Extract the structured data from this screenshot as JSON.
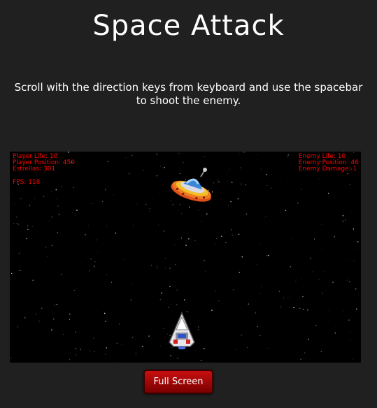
{
  "page": {
    "title": "Space Attack",
    "instructions": "Scroll with the direction keys from keyboard and use the spacebar to shoot the enemy."
  },
  "hud": {
    "player_life": "Player Life: 10",
    "player_position": "Player Position: 450",
    "stars": "Estrellas: 301",
    "fps": "FPS: 118",
    "enemy_life": "Enemy Life: 10",
    "enemy_position": "Enemy Position: 46",
    "enemy_damage": "Enemy Damage: 1"
  },
  "game": {
    "enemy_sprite": "ufo-icon",
    "player_sprite": "spaceship-icon"
  },
  "controls": {
    "fullscreen_label": "Full Screen"
  },
  "colors": {
    "background": "#202020",
    "canvas": "#000000",
    "hud_text": "#ff0000",
    "button": "#b00000"
  }
}
